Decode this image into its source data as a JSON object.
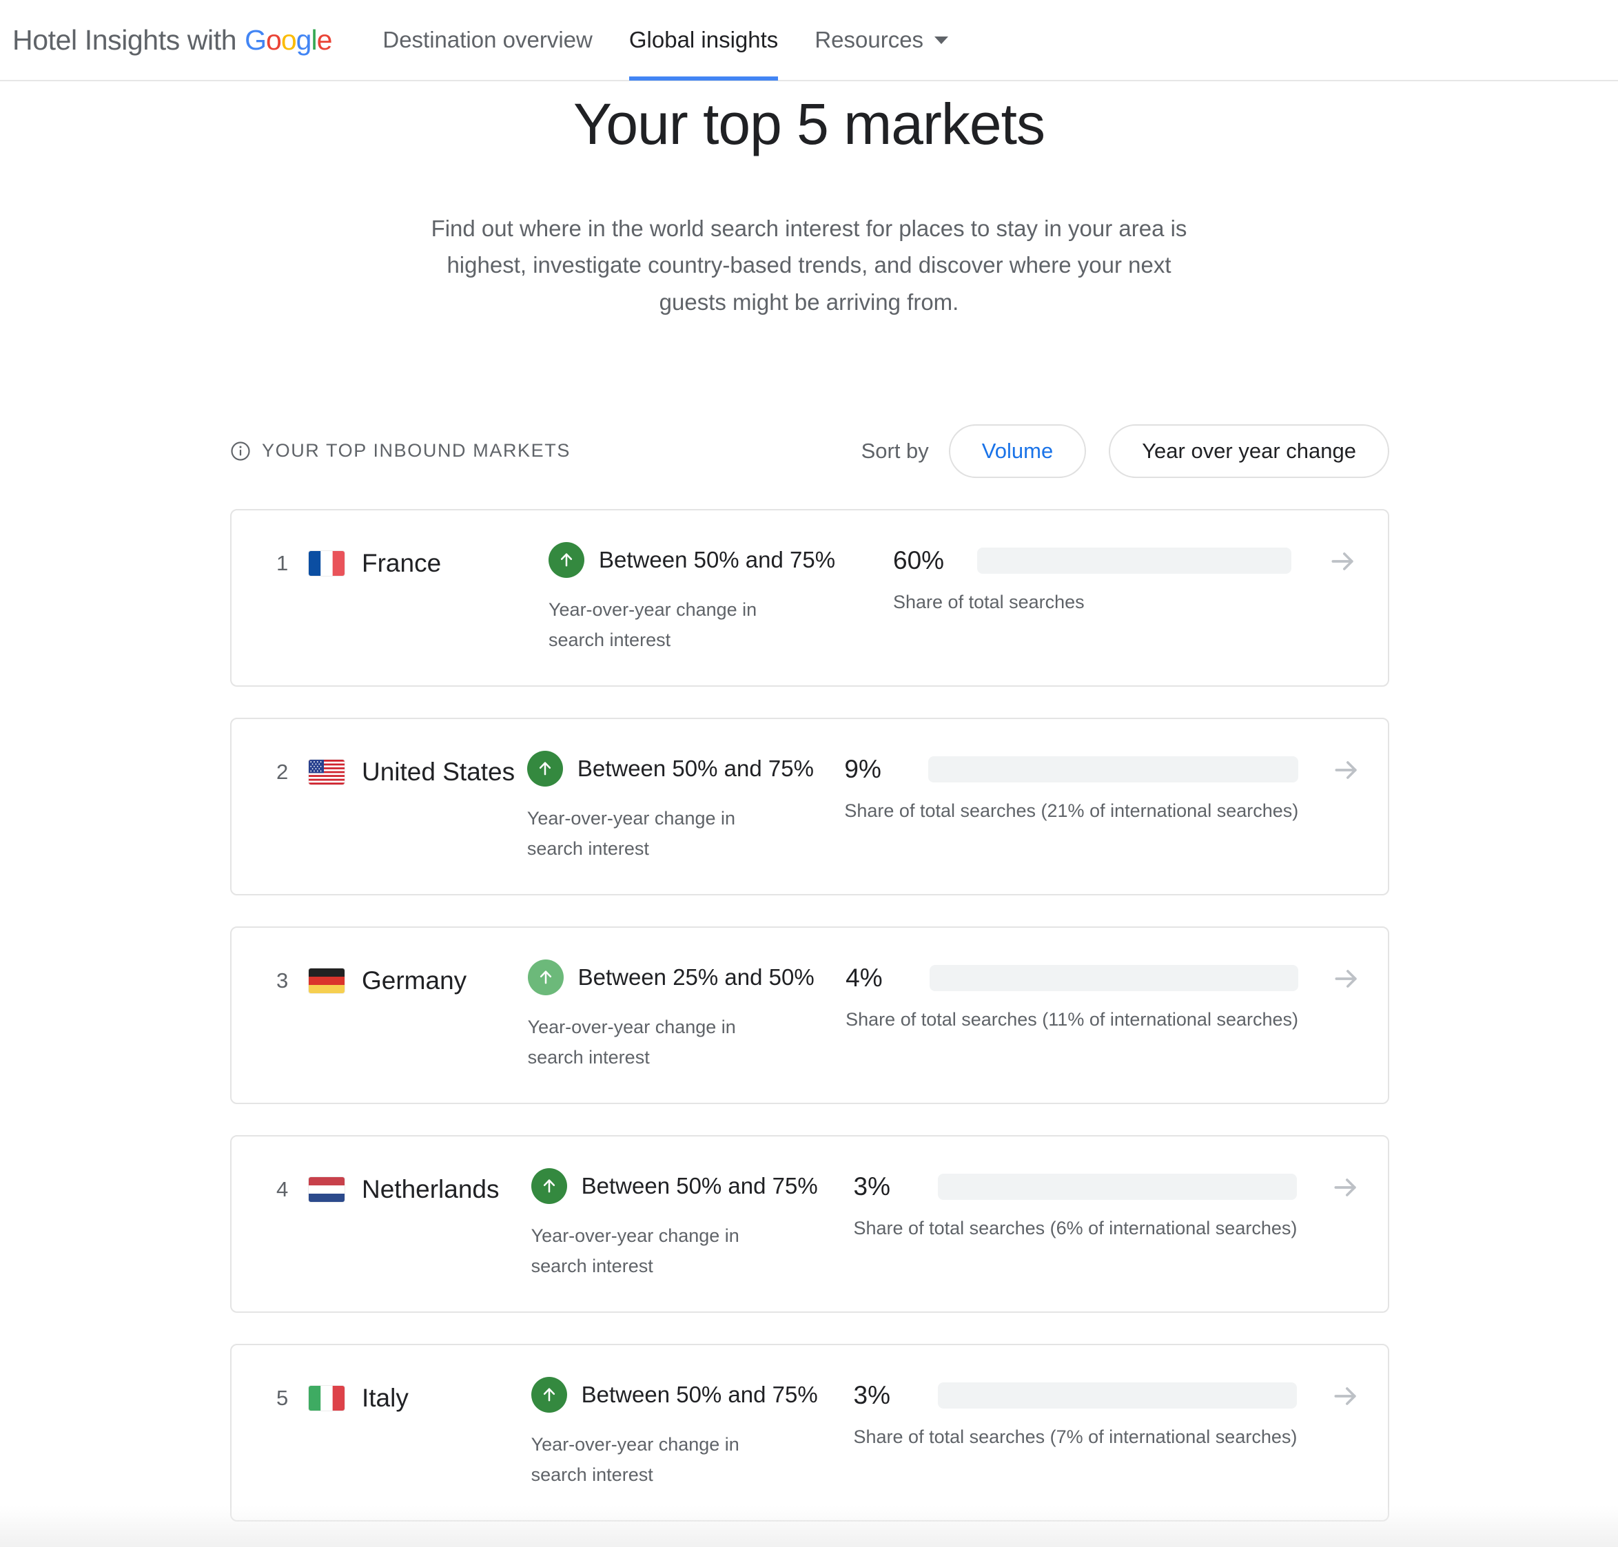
{
  "header": {
    "brand_text": "Hotel Insights with",
    "brand_google": "Google",
    "nav": [
      {
        "label": "Destination overview",
        "active": false,
        "has_caret": false
      },
      {
        "label": "Global insights",
        "active": true,
        "has_caret": false
      },
      {
        "label": "Resources",
        "active": false,
        "has_caret": true
      }
    ]
  },
  "hero": {
    "title": "Your top 5 markets",
    "description": "Find out where in the world search interest for places to stay in your area is highest, investigate country-based trends, and discover where your next guests might be arriving from."
  },
  "section": {
    "title": "YOUR TOP INBOUND MARKETS",
    "info_icon": "info-circle-icon",
    "sort_label": "Sort by",
    "sort_options": [
      {
        "label": "Volume",
        "selected": true
      },
      {
        "label": "Year over year change",
        "selected": false
      }
    ]
  },
  "colors": {
    "accent_blue": "#4285F4",
    "link_blue": "#1a73e8",
    "bar_orange": "#E8A33D",
    "bar_blue": "#5A8EE8",
    "badge_green_strong": "#34893f",
    "badge_green_light": "#6cb97a",
    "track_grey": "#f1f3f4"
  },
  "chart_data": {
    "type": "bar",
    "title": "Your top inbound markets — share of total searches",
    "xlabel": "",
    "ylabel": "Share of total searches",
    "categories": [
      "France",
      "United States",
      "Germany",
      "Netherlands",
      "Italy"
    ],
    "values": [
      60,
      9,
      4,
      3,
      3
    ],
    "value_labels": [
      "60%",
      "9%",
      "4%",
      "3%",
      "3%"
    ],
    "ylim": [
      0,
      100
    ],
    "grid": false,
    "legend": "none",
    "series": [
      {
        "name": "Share of total searches (%)",
        "values": [
          60,
          9,
          4,
          3,
          3
        ]
      },
      {
        "name": "Share of international searches (%)",
        "values": [
          null,
          21,
          11,
          6,
          7
        ]
      }
    ],
    "annotations": [
      "France: Between 50% and 75% year-over-year change in search interest",
      "United States: Between 50% and 75% year-over-year change in search interest",
      "Germany: Between 25% and 50% year-over-year change in search interest",
      "Netherlands: Between 50% and 75% year-over-year change in search interest",
      "Italy: Between 50% and 75% year-over-year change in search interest"
    ]
  },
  "markets": [
    {
      "rank": "1",
      "country": "France",
      "flag": "flag-france",
      "yoy_text": "Between 50% and 75%",
      "yoy_caption": "Year-over-year change in search interest",
      "trend": "up",
      "badge_color": "#34893f",
      "share_pct_label": "60%",
      "share_pct_value": 60,
      "bar_fill_ratio": 47,
      "bar_color": "#E8A33D",
      "share_caption": "Share of total searches",
      "arrow_icon": "arrow-right-icon"
    },
    {
      "rank": "2",
      "country": "United States",
      "flag": "flag-united-states",
      "yoy_text": "Between 50% and 75%",
      "yoy_caption": "Year-over-year change in search interest",
      "trend": "up",
      "badge_color": "#34893f",
      "share_pct_label": "9%",
      "share_pct_value": 9,
      "bar_fill_ratio": 7.2,
      "bar_color": "#5A8EE8",
      "share_caption": "Share of total searches (21% of international searches)",
      "arrow_icon": "arrow-right-icon"
    },
    {
      "rank": "3",
      "country": "Germany",
      "flag": "flag-germany",
      "yoy_text": "Between 25% and 50%",
      "yoy_caption": "Year-over-year change in search interest",
      "trend": "up",
      "badge_color": "#6cb97a",
      "share_pct_label": "4%",
      "share_pct_value": 4,
      "bar_fill_ratio": 3.6,
      "bar_color": "#5A8EE8",
      "share_caption": "Share of total searches (11% of international searches)",
      "arrow_icon": "arrow-right-icon"
    },
    {
      "rank": "4",
      "country": "Netherlands",
      "flag": "flag-netherlands",
      "yoy_text": "Between 50% and 75%",
      "yoy_caption": "Year-over-year change in search interest",
      "trend": "up",
      "badge_color": "#34893f",
      "share_pct_label": "3%",
      "share_pct_value": 3,
      "bar_fill_ratio": 3.3,
      "bar_color": "#5A8EE8",
      "share_caption": "Share of total searches (6% of international searches)",
      "arrow_icon": "arrow-right-icon"
    },
    {
      "rank": "5",
      "country": "Italy",
      "flag": "flag-italy",
      "yoy_text": "Between 50% and 75%",
      "yoy_caption": "Year-over-year change in search interest",
      "trend": "up",
      "badge_color": "#34893f",
      "share_pct_label": "3%",
      "share_pct_value": 3,
      "bar_fill_ratio": 3.3,
      "bar_color": "#5A8EE8",
      "share_caption": "Share of total searches (7% of international searches)",
      "arrow_icon": "arrow-right-icon"
    }
  ]
}
